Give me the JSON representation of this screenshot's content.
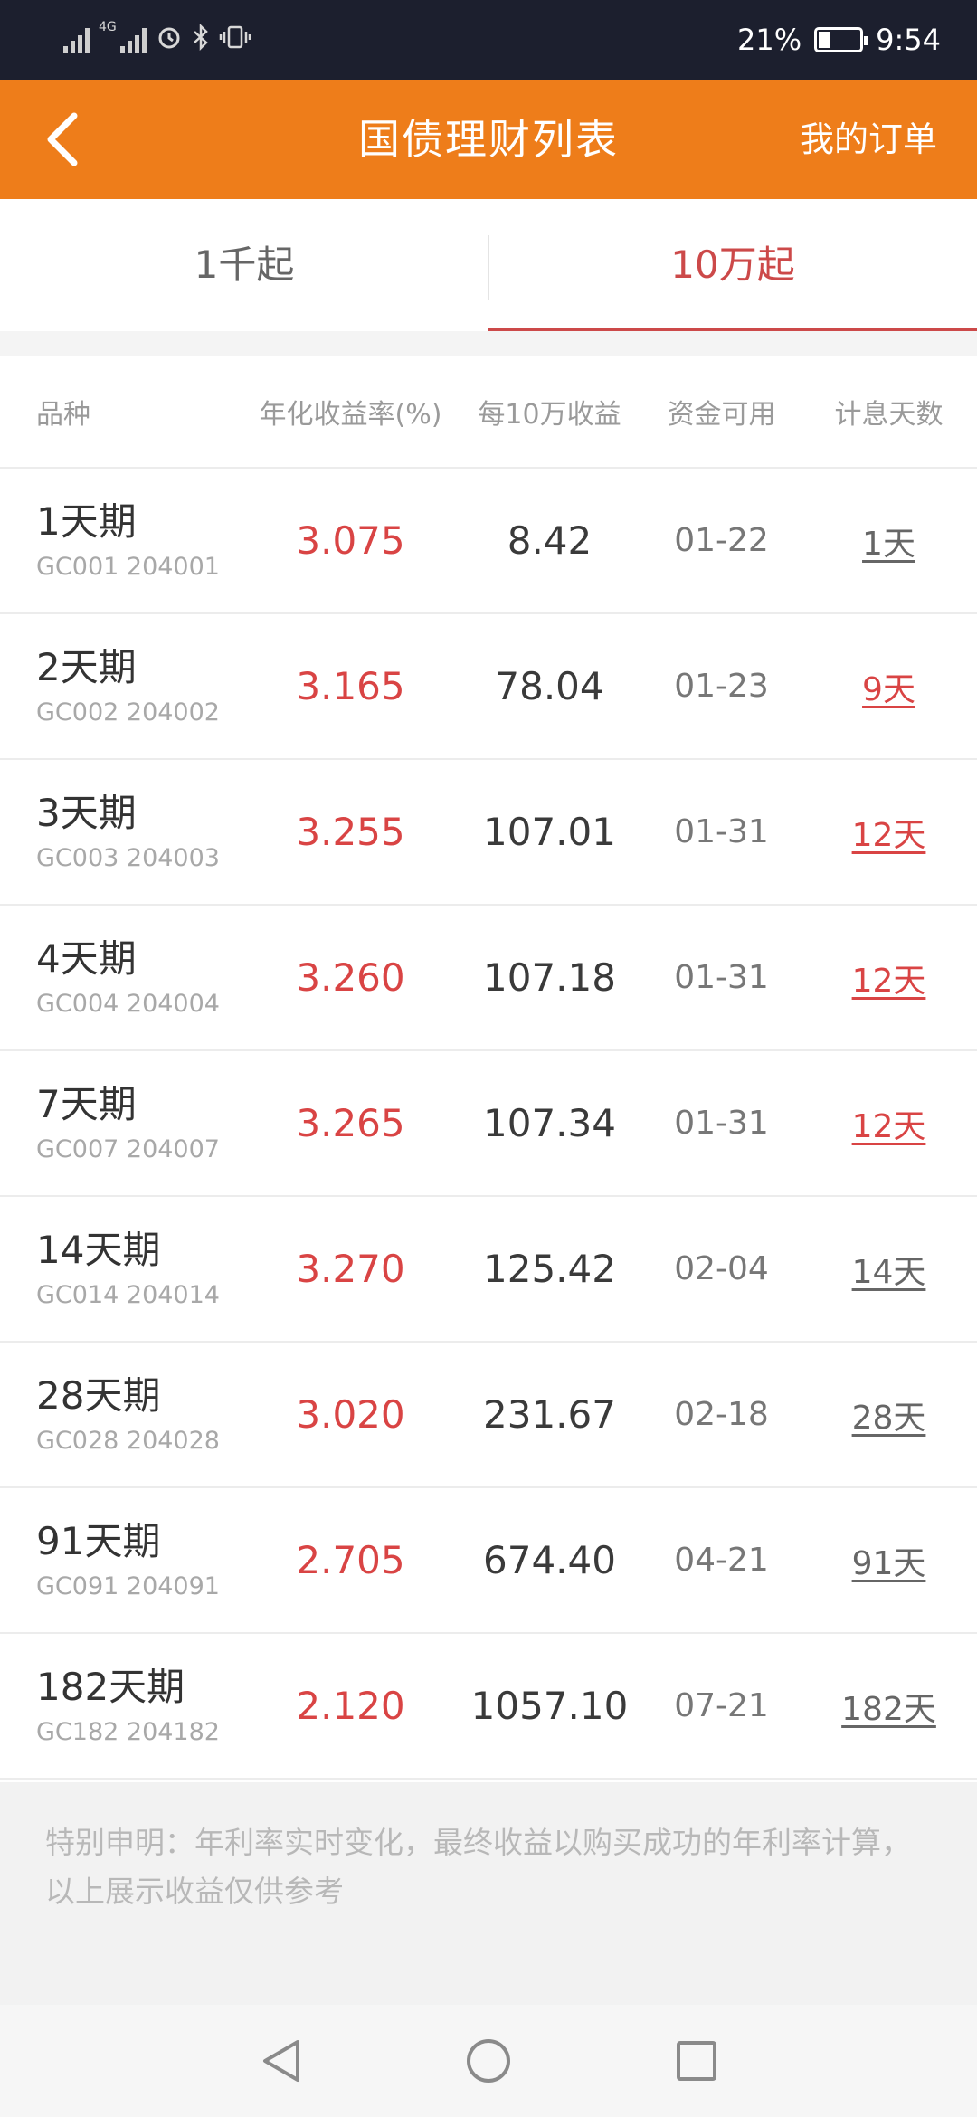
{
  "status_bar": {
    "network_label": "4G",
    "battery_percent": "21%",
    "time": "9:54"
  },
  "header": {
    "title": "国债理财列表",
    "right_action": "我的订单",
    "back_icon": "chevron-left-icon",
    "background_color": "#ee7d1a"
  },
  "tabs": [
    {
      "label": "1千起",
      "active": false
    },
    {
      "label": "10万起",
      "active": true
    }
  ],
  "table": {
    "headers": [
      "品种",
      "年化收益率(%)",
      "每10万收益",
      "资金可用",
      "计息天数"
    ],
    "rows": [
      {
        "term": "1天期",
        "code": "GC001 204001",
        "rate": "3.075",
        "earnings": "8.42",
        "available": "01-22",
        "days": "1天",
        "days_highlight": false
      },
      {
        "term": "2天期",
        "code": "GC002 204002",
        "rate": "3.165",
        "earnings": "78.04",
        "available": "01-23",
        "days": "9天",
        "days_highlight": true
      },
      {
        "term": "3天期",
        "code": "GC003 204003",
        "rate": "3.255",
        "earnings": "107.01",
        "available": "01-31",
        "days": "12天",
        "days_highlight": true
      },
      {
        "term": "4天期",
        "code": "GC004 204004",
        "rate": "3.260",
        "earnings": "107.18",
        "available": "01-31",
        "days": "12天",
        "days_highlight": true
      },
      {
        "term": "7天期",
        "code": "GC007 204007",
        "rate": "3.265",
        "earnings": "107.34",
        "available": "01-31",
        "days": "12天",
        "days_highlight": true
      },
      {
        "term": "14天期",
        "code": "GC014 204014",
        "rate": "3.270",
        "earnings": "125.42",
        "available": "02-04",
        "days": "14天",
        "days_highlight": false
      },
      {
        "term": "28天期",
        "code": "GC028 204028",
        "rate": "3.020",
        "earnings": "231.67",
        "available": "02-18",
        "days": "28天",
        "days_highlight": false
      },
      {
        "term": "91天期",
        "code": "GC091 204091",
        "rate": "2.705",
        "earnings": "674.40",
        "available": "04-21",
        "days": "91天",
        "days_highlight": false
      },
      {
        "term": "182天期",
        "code": "GC182 204182",
        "rate": "2.120",
        "earnings": "1057.10",
        "available": "07-21",
        "days": "182天",
        "days_highlight": false
      }
    ]
  },
  "disclaimer": "特别申明：年利率实时变化，最终收益以购买成功的年利率计算，以上展示收益仅供参考",
  "nav_bar": {
    "back_icon": "triangle-back-icon",
    "home_icon": "circle-home-icon",
    "recents_icon": "square-recents-icon"
  },
  "colors": {
    "accent_orange": "#ee7d1a",
    "rate_red": "#d94444",
    "status_bar": "#1c1f2e"
  }
}
